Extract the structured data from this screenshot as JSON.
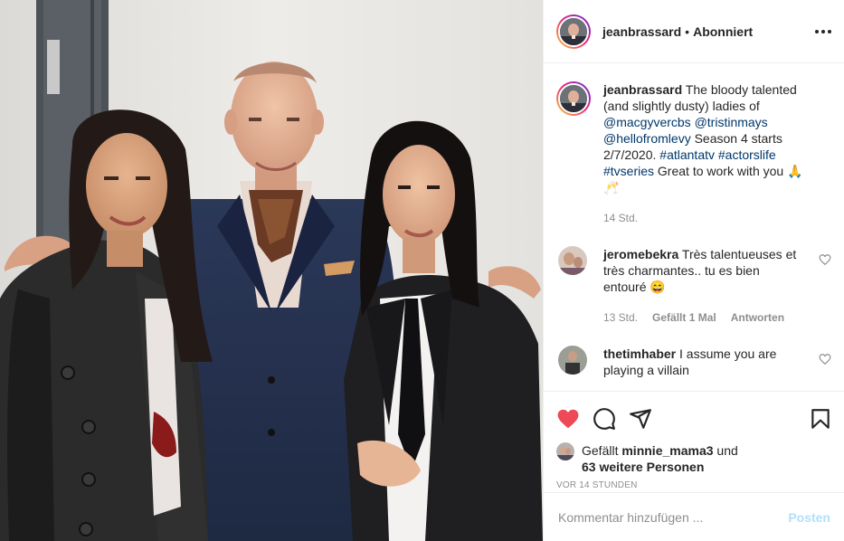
{
  "colors": {
    "link": "#00376b",
    "muted": "#8e8e8e",
    "like_red": "#ed4956",
    "post_disabled": "#b2dffc",
    "border": "#efefef"
  },
  "header": {
    "username": "jeanbrassard",
    "separator": "•",
    "follow_status": "Abonniert"
  },
  "caption": {
    "username": "jeanbrassard",
    "text_1": " The bloody talented (and slightly dusty) ladies of ",
    "tag_1": "@macgyvercbs",
    "tag_2": "@tristinmays",
    "tag_3": "@hellofromlevy",
    "text_2": " Season 4 starts 2/7/2020. ",
    "tag_4": "#atlantatv",
    "tag_5": "#actorslife",
    "tag_6": "#tvseries",
    "text_3": " Great to work with you 🙏🥂",
    "time": "14 Std."
  },
  "comments": [
    {
      "username": "jeromebekra",
      "text": " Très talentueuses et très charmantes.. tu es bien entouré 😄",
      "time": "13 Std.",
      "likes": "Gefällt 1 Mal",
      "reply": "Antworten"
    },
    {
      "username": "thetimhaber",
      "text": " I assume you are playing a villain"
    }
  ],
  "actions": {
    "like_icon": "heart-filled-icon",
    "comment_icon": "comment-bubble-icon",
    "share_icon": "paper-plane-icon",
    "save_icon": "bookmark-icon"
  },
  "likes": {
    "prefix": "Gefällt ",
    "user": "minnie_mama3",
    "middle": " und ",
    "others": "63 weitere Personen"
  },
  "posted_ago": "VOR 14 STUNDEN",
  "add_comment": {
    "placeholder": "Kommentar hinzufügen ...",
    "post_label": "Posten"
  }
}
